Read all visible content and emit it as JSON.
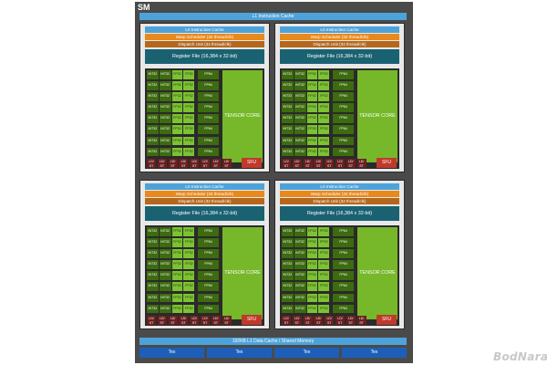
{
  "sm_label": "SM",
  "l1_cache": "L1 Instruction Cache",
  "partition": {
    "l0_cache": "L0 Instruction Cache",
    "warp_scheduler": "Warp Scheduler (32 thread/clk)",
    "dispatch_unit": "Dispatch Unit (32 thread/clk)",
    "register_file": "Register File (16,384 x 32-bit)",
    "int32": "INT32",
    "fp32": "FP32",
    "fp64": "FP64",
    "tensor_core": "TENSOR CORE",
    "ldst": "LD/ ST",
    "sfu": "SFU"
  },
  "partitions": [
    {
      "id": "p0"
    },
    {
      "id": "p1"
    },
    {
      "id": "p2"
    },
    {
      "id": "p3"
    }
  ],
  "l1_data": "192KB L1 Data Cache / Shared Memory",
  "tex_units": [
    "Tex",
    "Tex",
    "Tex",
    "Tex"
  ],
  "watermark": "BodNara",
  "colors": {
    "cache": "#4da3d9",
    "warp": "#e8891c",
    "dispatch": "#b5671c",
    "register": "#1a6272",
    "int32": "#3d6b10",
    "fp32": "#7cc232",
    "tensor": "#76b82a",
    "ldst": "#6b1f1f",
    "sfu": "#c0392b",
    "tex": "#1d5fb8"
  }
}
